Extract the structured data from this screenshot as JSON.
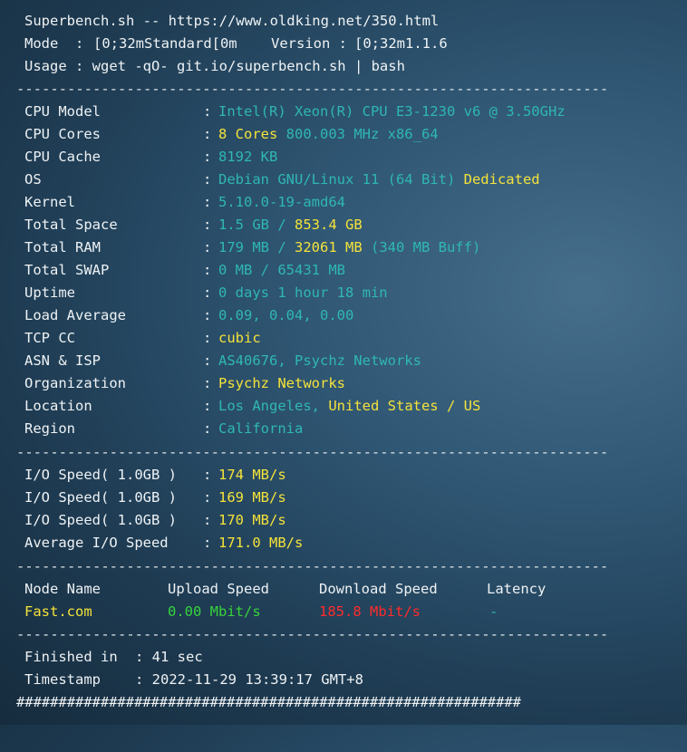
{
  "header": {
    "title_line": "Superbench.sh -- https://www.oldking.net/350.html",
    "mode_label": "Mode  : ",
    "mode_value": "[0;32mStandard[0m",
    "version_label": "Version : ",
    "version_value": "[0;32m1.1.6",
    "usage_line": "Usage : wget -qO- git.io/superbench.sh | bash"
  },
  "separator": "----------------------------------------------------------------------",
  "system": {
    "cpu_model": {
      "key": "CPU Model",
      "value": "Intel(R) Xeon(R) CPU E3-1230 v6 @ 3.50GHz"
    },
    "cpu_cores": {
      "key": "CPU Cores",
      "cores": "8 Cores",
      "rest": " 800.003 MHz x86_64"
    },
    "cpu_cache": {
      "key": "CPU Cache",
      "value": "8192 KB"
    },
    "os": {
      "key": "OS",
      "value": "Debian GNU/Linux 11 (64 Bit)",
      "type": " Dedicated"
    },
    "kernel": {
      "key": "Kernel",
      "value": "5.10.0-19-amd64"
    },
    "total_space": {
      "key": "Total Space",
      "used": "1.5 GB / ",
      "total": "853.4 GB"
    },
    "total_ram": {
      "key": "Total RAM",
      "used": "179 MB / ",
      "total": "32061 MB",
      "buff": " (340 MB Buff)"
    },
    "total_swap": {
      "key": "Total SWAP",
      "value": "0 MB / 65431 MB"
    },
    "uptime": {
      "key": "Uptime",
      "value": "0 days 1 hour 18 min"
    },
    "load_average": {
      "key": "Load Average",
      "value": "0.09, 0.04, 0.00"
    },
    "tcp_cc": {
      "key": "TCP CC",
      "value": "cubic"
    },
    "asn_isp": {
      "key": "ASN & ISP",
      "value": "AS40676, Psychz Networks"
    },
    "organization": {
      "key": "Organization",
      "value": "Psychz Networks"
    },
    "location": {
      "key": "Location",
      "city": "Los Angeles, ",
      "country": "United States / US"
    },
    "region": {
      "key": "Region",
      "value": "California"
    }
  },
  "colon": ": ",
  "io": [
    {
      "key": "I/O Speed( 1.0GB )",
      "value": "174 MB/s"
    },
    {
      "key": "I/O Speed( 1.0GB )",
      "value": "169 MB/s"
    },
    {
      "key": "I/O Speed( 1.0GB )",
      "value": "170 MB/s"
    },
    {
      "key": "Average I/O Speed",
      "value": "171.0 MB/s"
    }
  ],
  "speedtest": {
    "headers": {
      "node": "Node Name",
      "upload": "Upload Speed",
      "download": "Download Speed",
      "latency": "Latency"
    },
    "rows": [
      {
        "node": "Fast.com",
        "upload": "0.00 Mbit/s",
        "download": "185.8 Mbit/s",
        "latency": "-"
      }
    ]
  },
  "footer": {
    "finished_key": "Finished in",
    "finished_value": ": 41 sec",
    "timestamp_key": "Timestamp",
    "timestamp_value": ": 2022-11-29 13:39:17 GMT+8",
    "hash_line": "############################################################"
  },
  "colors": {
    "text": "#eef2f4",
    "cyan": "#2fb7b4",
    "yellow": "#f4e23a",
    "green": "#36d43a",
    "red": "#ff2b2b"
  }
}
